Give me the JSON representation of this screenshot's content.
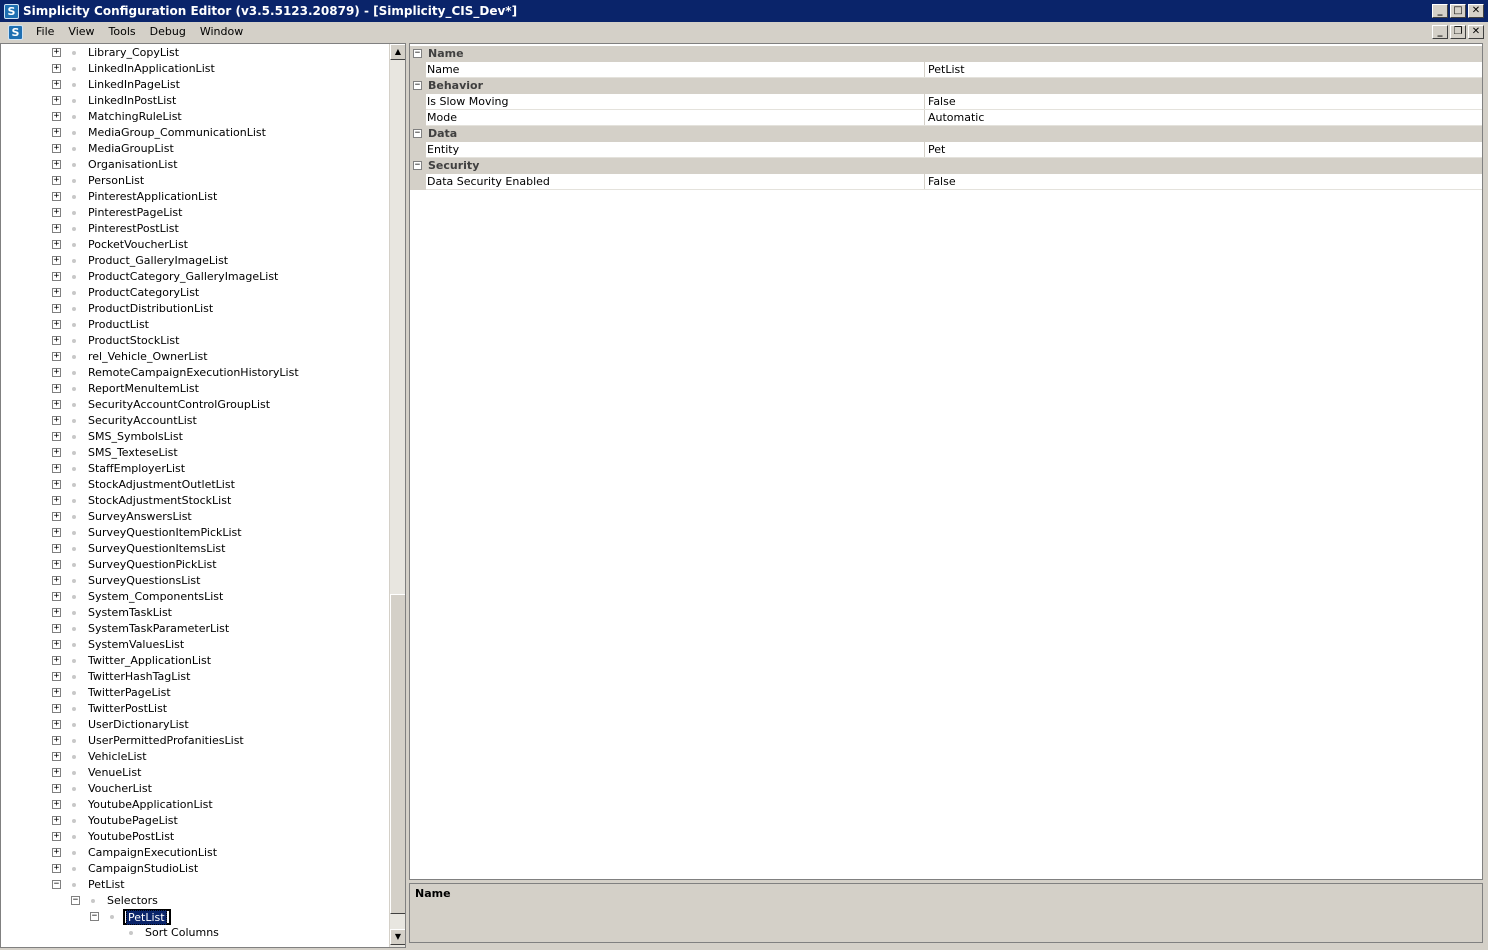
{
  "window": {
    "title": "Simplicity Configuration Editor (v3.5.5123.20879) - [Simplicity_CIS_Dev*]",
    "app_icon": "S",
    "controls": {
      "minimize": "_",
      "maximize": "□",
      "close": "✕"
    }
  },
  "menu": {
    "items": [
      "File",
      "View",
      "Tools",
      "Debug",
      "Window"
    ],
    "mdi_controls": {
      "minimize": "_",
      "restore": "❐",
      "close": "✕"
    }
  },
  "tree": {
    "top_items": [
      "Library_CopyList",
      "LinkedInApplicationList",
      "LinkedInPageList",
      "LinkedInPostList",
      "MatchingRuleList",
      "MediaGroup_CommunicationList",
      "MediaGroupList",
      "OrganisationList",
      "PersonList",
      "PinterestApplicationList",
      "PinterestPageList",
      "PinterestPostList",
      "PocketVoucherList",
      "Product_GalleryImageList",
      "ProductCategory_GalleryImageList",
      "ProductCategoryList",
      "ProductDistributionList",
      "ProductList",
      "ProductStockList",
      "rel_Vehicle_OwnerList",
      "RemoteCampaignExecutionHistoryList",
      "ReportMenuItemList",
      "SecurityAccountControlGroupList",
      "SecurityAccountList",
      "SMS_SymbolsList",
      "SMS_TexteseList",
      "StaffEmployerList",
      "StockAdjustmentOutletList",
      "StockAdjustmentStockList",
      "SurveyAnswersList",
      "SurveyQuestionItemPickList",
      "SurveyQuestionItemsList",
      "SurveyQuestionPickList",
      "SurveyQuestionsList",
      "System_ComponentsList",
      "SystemTaskList",
      "SystemTaskParameterList",
      "SystemValuesList",
      "Twitter_ApplicationList",
      "TwitterHashTagList",
      "TwitterPageList",
      "TwitterPostList",
      "UserDictionaryList",
      "UserPermittedProfanitiesList",
      "VehicleList",
      "VenueList",
      "VoucherList",
      "YoutubeApplicationList",
      "YoutubePageList",
      "YoutubePostList",
      "CampaignExecutionList",
      "CampaignStudioList"
    ],
    "expanded_item": "PetList",
    "selectors_label": "Selectors",
    "selected_item": "PetList",
    "sort_columns_label": "Sort Columns",
    "expand_glyph": "+",
    "collapse_glyph": "−"
  },
  "properties": {
    "categories": [
      {
        "label": "Name",
        "rows": [
          {
            "name": "Name",
            "value": "PetList"
          }
        ]
      },
      {
        "label": "Behavior",
        "rows": [
          {
            "name": "Is Slow Moving",
            "value": "False"
          },
          {
            "name": "Mode",
            "value": "Automatic"
          }
        ]
      },
      {
        "label": "Data",
        "rows": [
          {
            "name": "Entity",
            "value": "Pet"
          }
        ]
      },
      {
        "label": "Security",
        "rows": [
          {
            "name": "Data Security Enabled",
            "value": "False"
          }
        ]
      }
    ]
  },
  "description": {
    "title": "Name"
  },
  "scrollbar": {
    "up": "▲",
    "down": "▼"
  }
}
